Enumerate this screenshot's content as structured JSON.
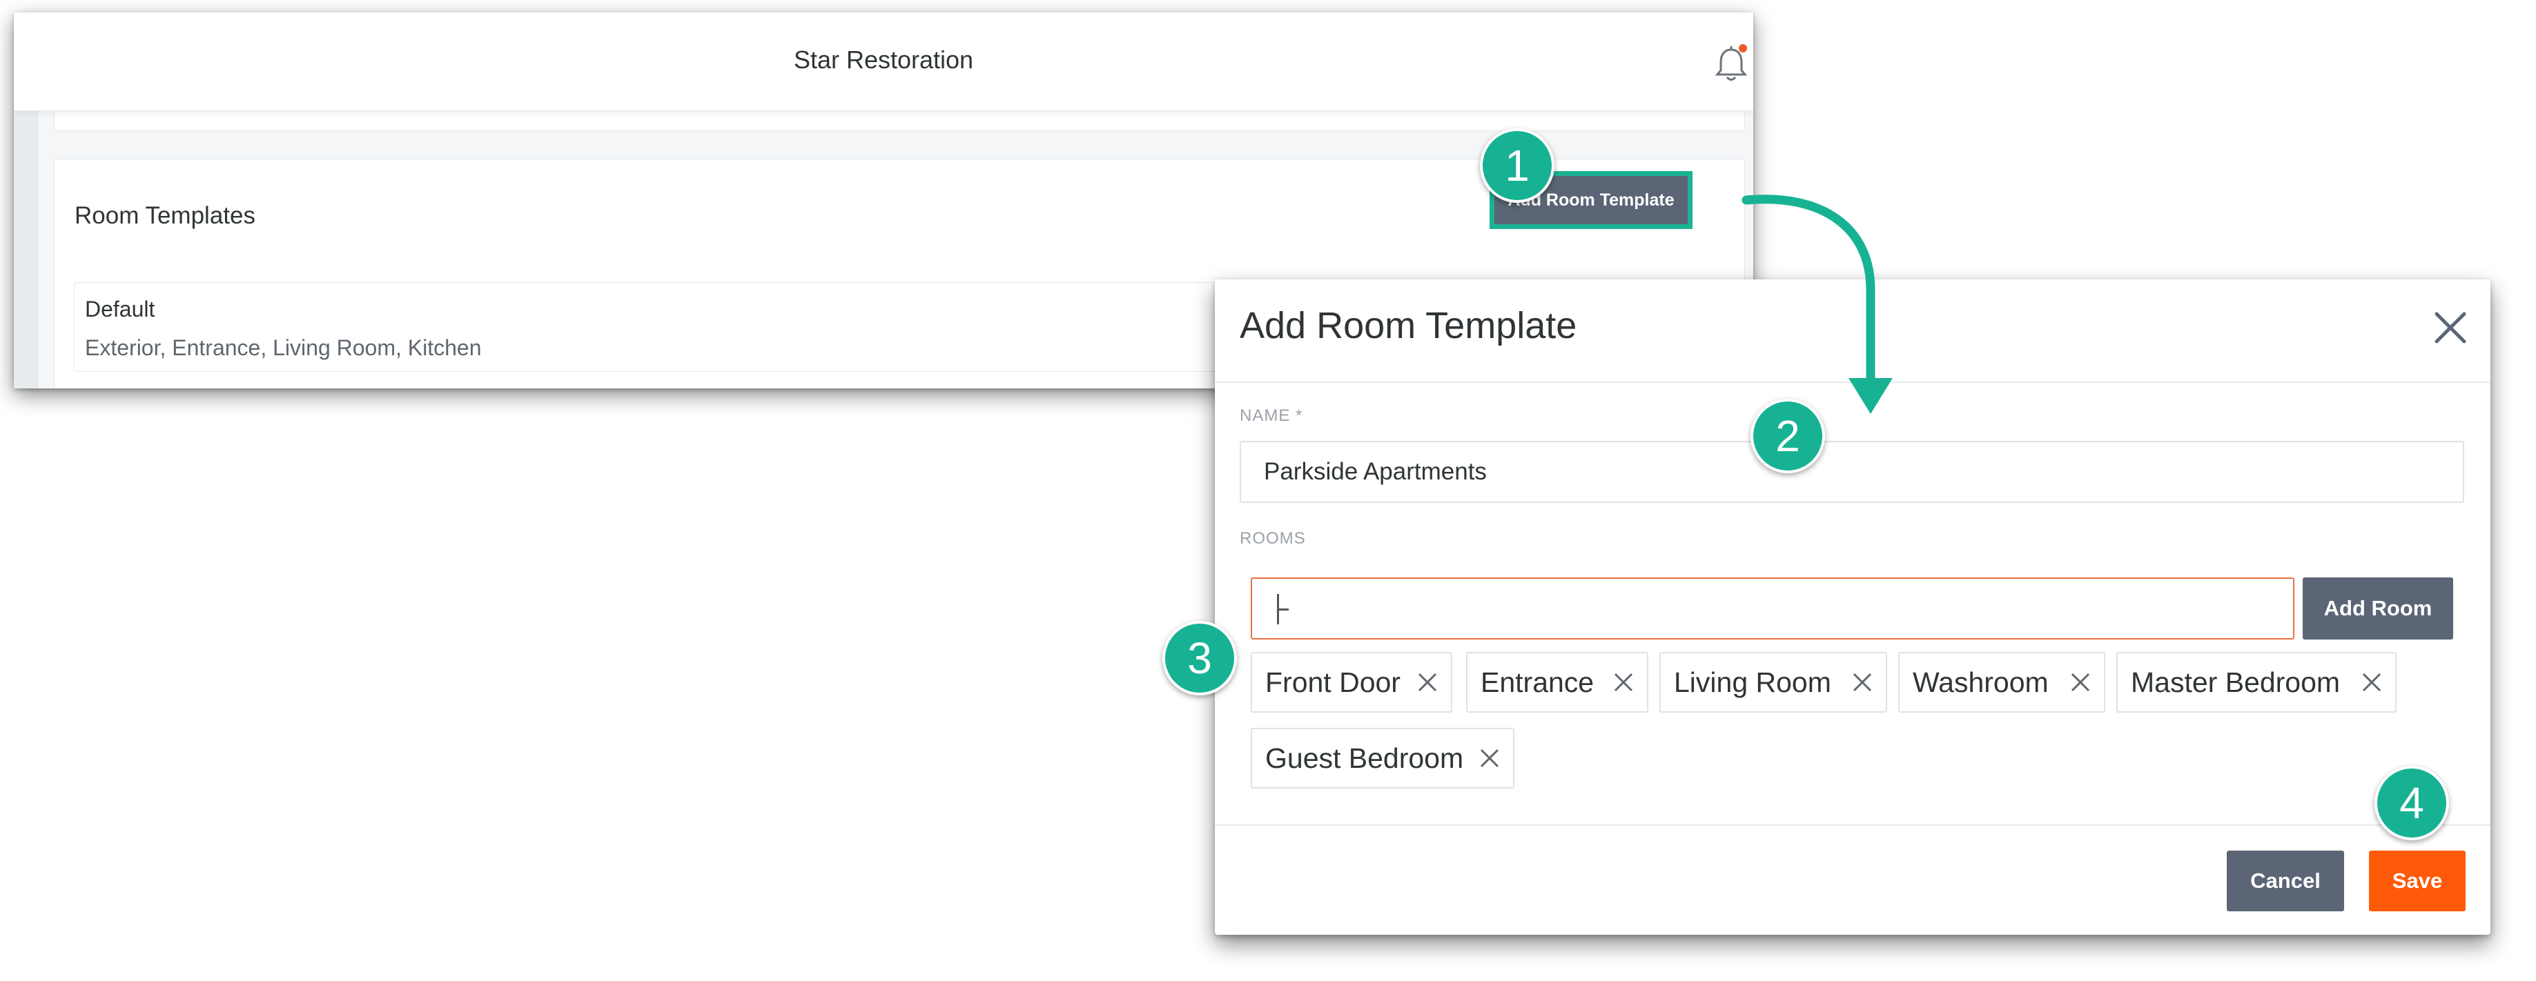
{
  "app": {
    "title": "Star Restoration",
    "notification_icon": "bell-icon"
  },
  "room_templates": {
    "title": "Room Templates",
    "add_button": "Add Room Template",
    "items": [
      {
        "name": "Default",
        "rooms": "Exterior, Entrance, Living Room, Kitchen"
      }
    ]
  },
  "modal": {
    "title": "Add Room Template",
    "name_label": "NAME *",
    "name_value": "Parkside Apartments",
    "rooms_label": "ROOMS",
    "add_room_button": "Add Room",
    "rooms": [
      "Front Door",
      "Entrance",
      "Living Room",
      "Washroom",
      "Master Bedroom",
      "Guest Bedroom"
    ],
    "cancel_button": "Cancel",
    "save_button": "Save"
  },
  "steps": [
    "1",
    "2",
    "3",
    "4"
  ],
  "colors": {
    "accent_teal": "#17b294",
    "save_orange": "#ff5a0a",
    "button_slate": "#5b6575",
    "focus_orange": "#e8733f",
    "notification_dot": "#f05a28"
  }
}
